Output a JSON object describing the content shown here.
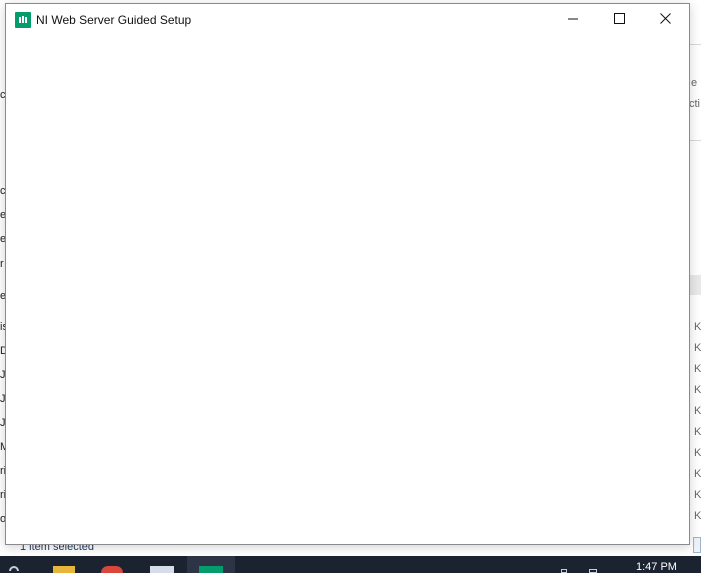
{
  "window": {
    "title": "NI Web Server Guided Setup",
    "app_icon_color": "#039c6a",
    "controls": [
      "minimize",
      "maximize",
      "close"
    ]
  },
  "background": {
    "status_text": "1 item selected",
    "left_fragments": [
      "c",
      "c",
      "e",
      "e",
      "r",
      "e",
      "is",
      "D",
      "Je",
      "Jo",
      "Jo",
      "M",
      "ri",
      "ri",
      "o"
    ],
    "right_fragments": [
      "e",
      "cti",
      "K",
      "K",
      "K",
      "K",
      "K",
      "K",
      "K",
      "K",
      "K",
      "K"
    ]
  },
  "taskbar": {
    "clock": "1:47 PM",
    "active_app_color": "#039c6a"
  }
}
